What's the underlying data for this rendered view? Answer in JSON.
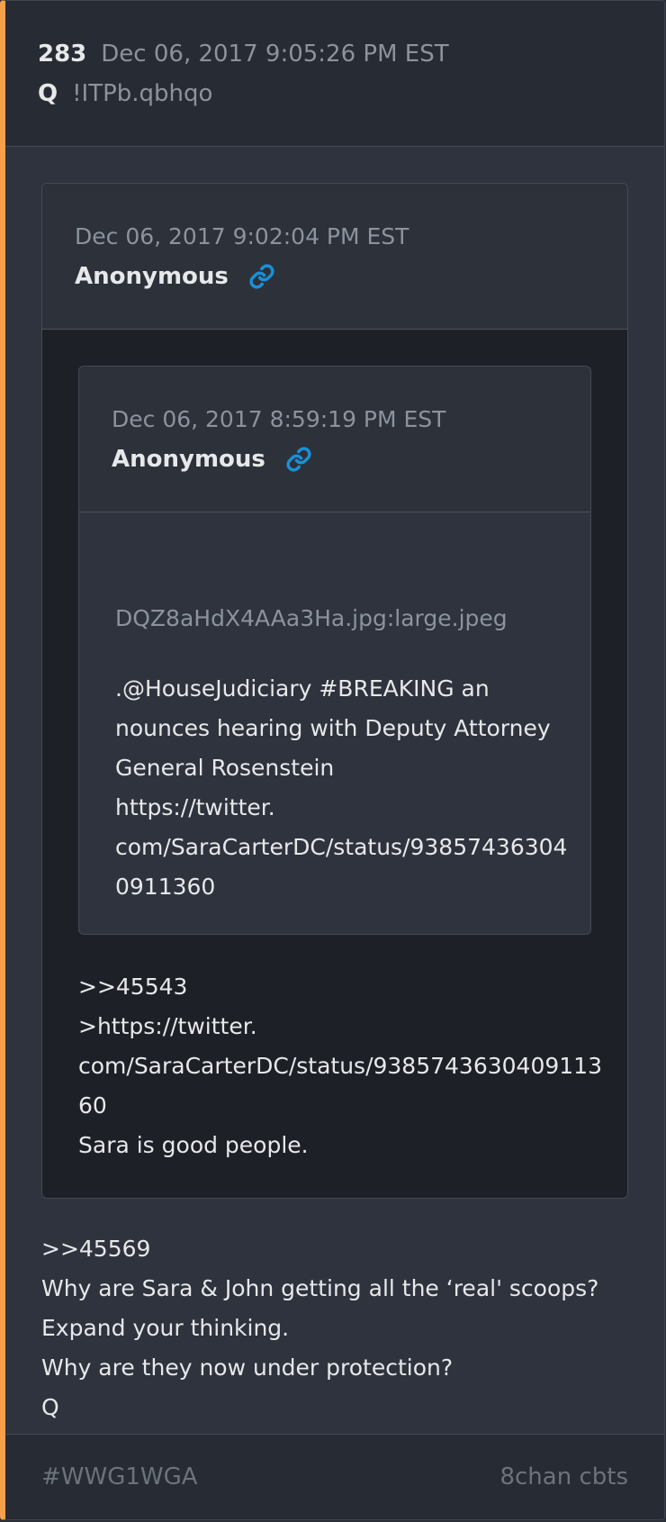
{
  "post": {
    "number": "283",
    "date": "Dec 06, 2017 9:05:26 PM EST",
    "author": "Q",
    "tripcode": "!ITPb.qbhqo"
  },
  "quote": {
    "date": "Dec 06, 2017 9:02:04 PM EST",
    "author": "Anonymous",
    "link_icon": "link-icon",
    "nested": {
      "date": "Dec 06, 2017 8:59:19 PM EST",
      "author": "Anonymous",
      "link_icon": "link-icon",
      "image_filename": "DQZ8aHdX4AAa3Ha.jpg:large.jpeg",
      "text": [
        ".@HouseJudiciary #BREAKING an",
        "nounces hearing with Deputy Attorney",
        "General Rosenstein",
        "https://twitter.",
        "com/SaraCarterDC/status/93857436304",
        "0911360"
      ]
    },
    "text": [
      ">>45543",
      ">https://twitter.",
      "com/SaraCarterDC/status/9385743630409113",
      "60",
      "Sara is good people."
    ]
  },
  "body": [
    ">>45569",
    "Why are Sara & John getting all the ‘real' scoops?",
    "Expand your thinking.",
    "Why are they now under protection?",
    "Q"
  ],
  "footer": {
    "tag": "#WWG1WGA",
    "source": "8chan cbts"
  },
  "colors": {
    "accent": "#f7a04b",
    "link_icon": "#1a8fd6",
    "background": "#2e333d"
  }
}
